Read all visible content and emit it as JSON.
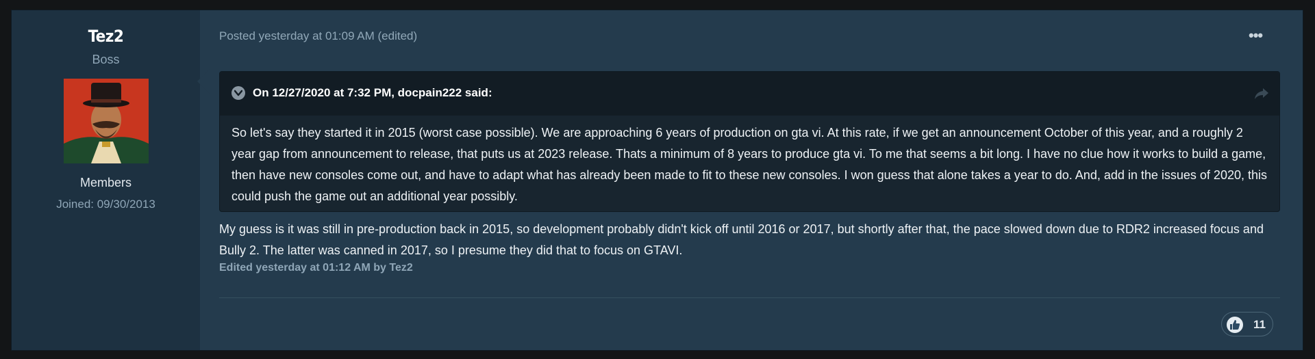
{
  "author": {
    "username": "Tez2",
    "rank": "Boss",
    "group": "Members",
    "joined": "Joined: 09/30/2013"
  },
  "post": {
    "meta": "Posted yesterday at 01:09 AM (edited)",
    "more_label": "•••",
    "quote": {
      "citation": "On 12/27/2020 at 7:32 PM, docpain222 said:",
      "body": "So let's say they started it in 2015 (worst case possible). We are approaching 6 years of production on gta vi. At this rate, if we get an announcement October of this year, and a roughly 2 year gap from announcement to release, that puts us at 2023 release. Thats a minimum of 8 years to produce gta vi. To me that seems a bit long. I have no clue how it works to build a game, then have new consoles come out, and have to adapt what has already been made to fit to these new consoles. I won guess that alone takes a year to do. And, add in the issues of 2020, this could push the game out an additional year possibly."
    },
    "body": "My guess is it was still in pre-production back in 2015, so development probably didn't kick off until 2016 or 2017, but shortly after that, the pace slowed down due to RDR2 increased focus and Bully 2. The latter was canned in 2017, so I presume they did that to focus on GTAVI.",
    "edited_note": "Edited yesterday at 01:12 AM by Tez2",
    "reactions": {
      "icon": "thumbs-up-icon",
      "count": "11"
    }
  },
  "colors": {
    "page_bg": "#131517",
    "post_bg": "#243b4d",
    "author_bg": "#1d3141",
    "quote_bg": "#18252f",
    "quote_head_bg": "#121c24",
    "muted_text": "#8fa6b7"
  }
}
